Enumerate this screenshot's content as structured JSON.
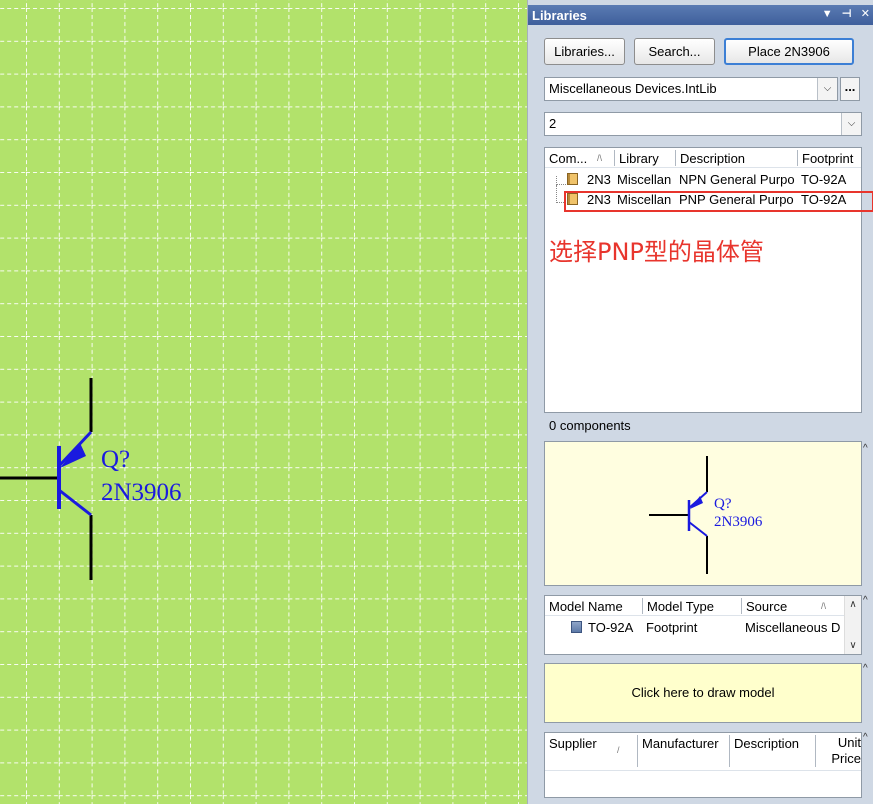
{
  "canvas": {
    "background_color": "#b2e26b",
    "symbol": {
      "designator": "Q?",
      "part": "2N3906",
      "color": "#1a1adf"
    }
  },
  "panel": {
    "title": "Libraries",
    "titlebar_icons": [
      "dropdown-icon",
      "pin-icon",
      "close-icon"
    ],
    "buttons": {
      "libraries": "Libraries...",
      "search": "Search...",
      "place": "Place 2N3906"
    },
    "library_select": {
      "value": "Miscellaneous Devices.IntLib",
      "extra": "..."
    },
    "filter_select": {
      "value": "2"
    },
    "components": {
      "columns": [
        "Com...",
        "Library",
        "Description",
        "Footprint"
      ],
      "rows": [
        {
          "component": "2N3",
          "library": "Miscellan",
          "description": "NPN General Purpo",
          "footprint": "TO-92A"
        },
        {
          "component": "2N3",
          "library": "Miscellan",
          "description": "PNP General Purpo",
          "footprint": "TO-92A"
        }
      ],
      "annotation": "选择PNP型的晶体管",
      "count_text": "0 components"
    },
    "preview": {
      "designator": "Q?",
      "part": "2N3906"
    },
    "models": {
      "columns": [
        "Model Name",
        "Model Type",
        "Source"
      ],
      "rows": [
        {
          "name": "TO-92A",
          "type": "Footprint",
          "source": "Miscellaneous D"
        }
      ]
    },
    "draw_model_text": "Click here to draw model",
    "suppliers": {
      "columns": [
        "Supplier",
        "Manufacturer",
        "Description",
        "Unit Price"
      ]
    },
    "colors": {
      "titlebar": "#4a6ca8",
      "highlight": "#e8352d",
      "accent_button_border": "#3c7fd5"
    }
  }
}
